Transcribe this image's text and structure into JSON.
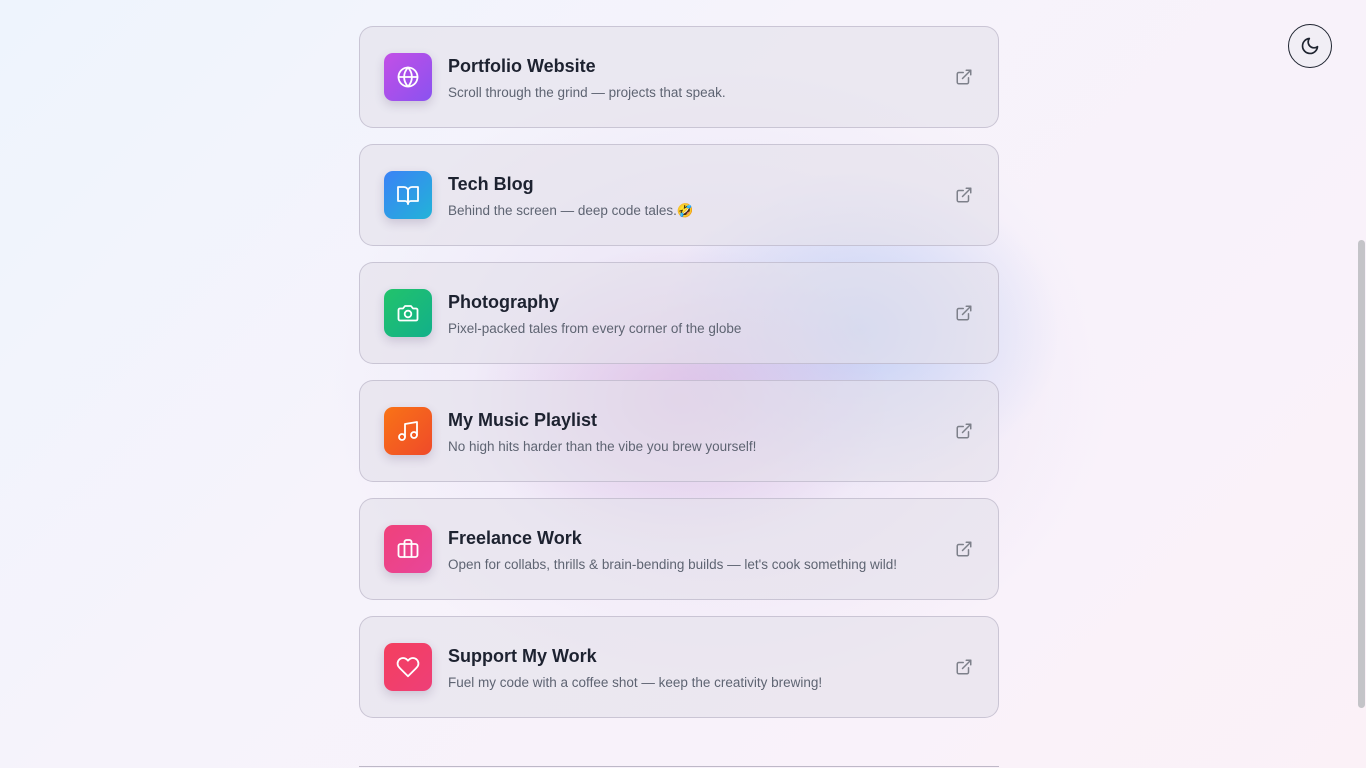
{
  "theme_toggle": {
    "icon": "moon-icon"
  },
  "links": [
    {
      "title": "Portfolio Website",
      "description": "Scroll through the grind — projects that speak.",
      "icon": "globe-icon",
      "gradient": [
        "#c34fe6",
        "#8a52f0"
      ]
    },
    {
      "title": "Tech Blog",
      "description": "Behind the screen — deep code tales.🤣",
      "icon": "book-open-icon",
      "gradient": [
        "#3b82f6",
        "#22b3d8"
      ]
    },
    {
      "title": "Photography",
      "description": "Pixel-packed tales from every corner of the globe",
      "icon": "camera-icon",
      "gradient": [
        "#22c36b",
        "#12b08a"
      ]
    },
    {
      "title": "My Music Playlist",
      "description": "No high hits harder than the vibe you brew yourself!",
      "icon": "music-note-icon",
      "gradient": [
        "#f97316",
        "#ef4a2a"
      ]
    },
    {
      "title": "Freelance Work",
      "description": "Open for collabs, thrills & brain-bending builds — let's cook something wild!",
      "icon": "briefcase-icon",
      "gradient": [
        "#f0417a",
        "#e8469a"
      ]
    },
    {
      "title": "Support My Work",
      "description": "Fuel my code with a coffee shot — keep the creativity brewing!",
      "icon": "heart-icon",
      "gradient": [
        "#f43f5e",
        "#ee3f78"
      ]
    }
  ],
  "external_link_icon": "external-link-icon"
}
